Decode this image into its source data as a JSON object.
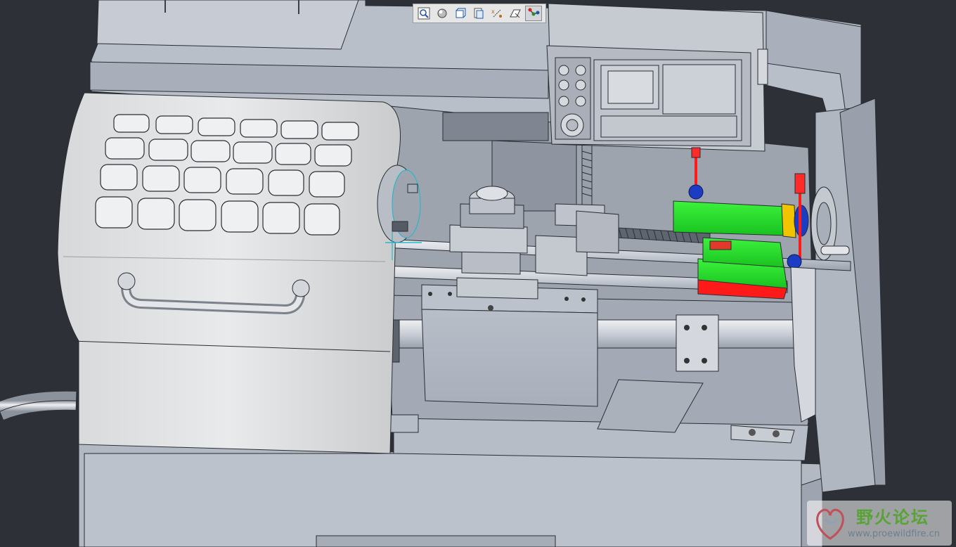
{
  "toolbar": {
    "items": [
      {
        "icon": "zoom-window-icon"
      },
      {
        "icon": "shading-icon"
      },
      {
        "icon": "hidden-line-icon"
      },
      {
        "icon": "saved-views-icon"
      },
      {
        "icon": "datum-display-icon"
      },
      {
        "icon": "datum-planes-icon"
      },
      {
        "icon": "mechanism-connections-icon",
        "active": true
      }
    ]
  },
  "watermark": {
    "title": "野火论坛",
    "url": "www.proewildfire.cn"
  },
  "colors": {
    "background": "#2d3037",
    "model_gray": "#b6bbc4",
    "highlight_green": "#22e02a",
    "highlight_red": "#ff1a1a",
    "highlight_yellow": "#f2c400",
    "joint_blue": "#1c3cc4"
  }
}
